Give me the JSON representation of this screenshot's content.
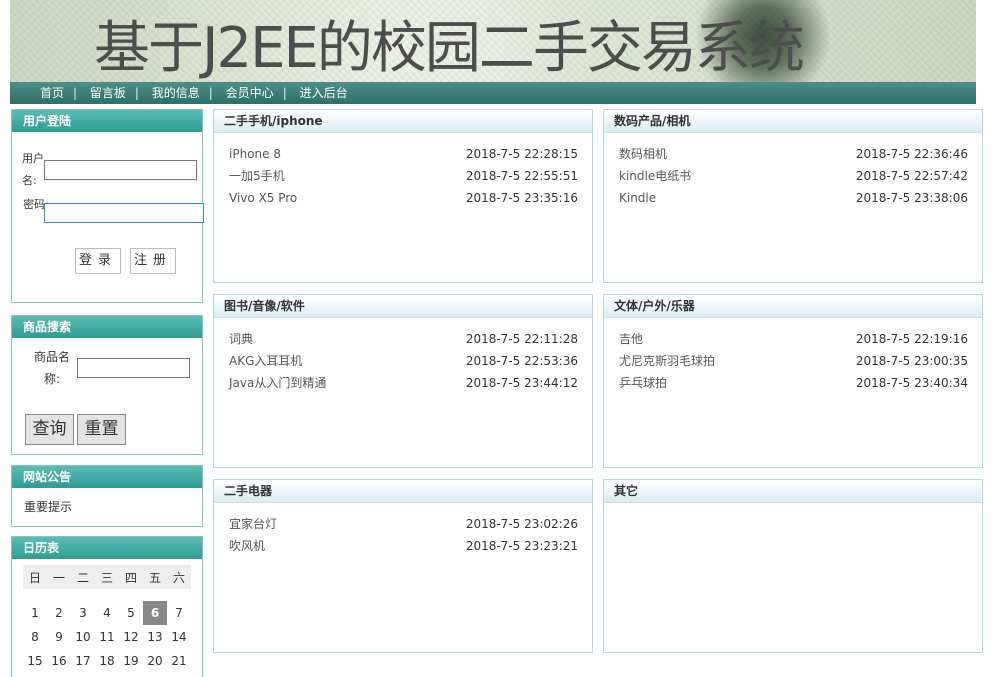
{
  "header": {
    "title": "基于J2EE的校园二手交易系统"
  },
  "nav": [
    "首页",
    "留言板",
    "我的信息",
    "会员中心",
    "进入后台"
  ],
  "nav_sep": "|",
  "login": {
    "title": "用户登陆",
    "username_label": "用户名:",
    "password_label": "密码:",
    "login_btn": "登录",
    "register_btn": "注册"
  },
  "search": {
    "title": "商品搜索",
    "name_label": "商品名称:",
    "query_btn": "查询",
    "reset_btn": "重置"
  },
  "notice": {
    "title": "网站公告",
    "text": "重要提示"
  },
  "calendar": {
    "title": "日历表",
    "weekdays": [
      "日",
      "一",
      "二",
      "三",
      "四",
      "五",
      "六"
    ],
    "weeks": [
      [
        "1",
        "2",
        "3",
        "4",
        "5",
        "6",
        "7"
      ],
      [
        "8",
        "9",
        "10",
        "11",
        "12",
        "13",
        "14"
      ],
      [
        "15",
        "16",
        "17",
        "18",
        "19",
        "20",
        "21"
      ]
    ],
    "today": "6"
  },
  "categories": [
    {
      "title": "二手手机/iphone",
      "items": [
        {
          "name": "iPhone 8",
          "time": "2018-7-5 22:28:15"
        },
        {
          "name": "一加5手机",
          "time": "2018-7-5 22:55:51"
        },
        {
          "name": "Vivo X5 Pro",
          "time": "2018-7-5 23:35:16"
        }
      ]
    },
    {
      "title": "数码产品/相机",
      "items": [
        {
          "name": "数码相机",
          "time": "2018-7-5 22:36:46"
        },
        {
          "name": "kindle电纸书",
          "time": "2018-7-5 22:57:42"
        },
        {
          "name": "Kindle",
          "time": "2018-7-5 23:38:06"
        }
      ]
    },
    {
      "title": "图书/音像/软件",
      "items": [
        {
          "name": "词典",
          "time": "2018-7-5 22:11:28"
        },
        {
          "name": "AKG入耳耳机",
          "time": "2018-7-5 22:53:36"
        },
        {
          "name": "Java从入门到精通",
          "time": "2018-7-5 23:44:12"
        }
      ]
    },
    {
      "title": "文体/户外/乐器",
      "items": [
        {
          "name": "吉他",
          "time": "2018-7-5 22:19:16"
        },
        {
          "name": "尤尼克斯羽毛球拍",
          "time": "2018-7-5 23:00:35"
        },
        {
          "name": "乒乓球拍",
          "time": "2018-7-5 23:40:34"
        }
      ]
    },
    {
      "title": "二手电器",
      "items": [
        {
          "name": "宜家台灯",
          "time": "2018-7-5 23:02:26"
        },
        {
          "name": "吹风机",
          "time": "2018-7-5 23:23:21"
        }
      ]
    },
    {
      "title": "其它",
      "items": []
    }
  ]
}
